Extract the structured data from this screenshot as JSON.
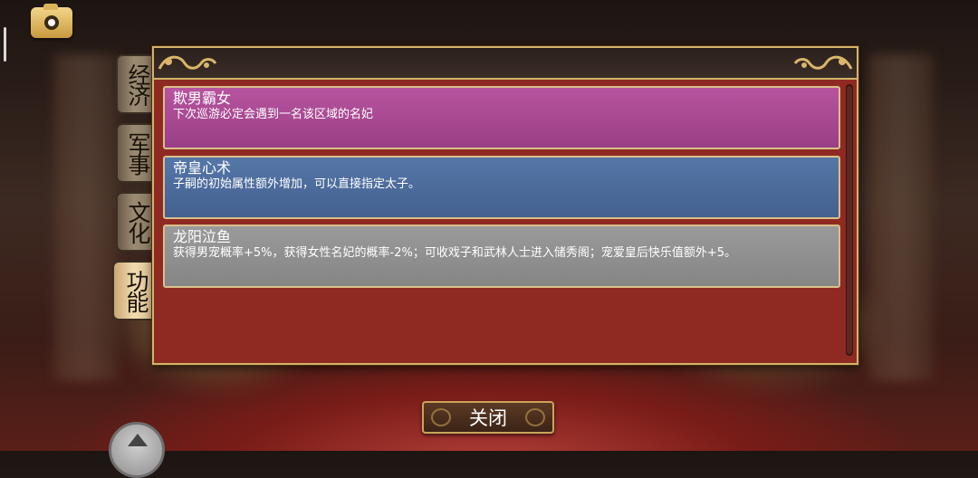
{
  "tabs": [
    {
      "label": "经济",
      "active": false
    },
    {
      "label": "军事",
      "active": false
    },
    {
      "label": "文化",
      "active": false
    },
    {
      "label": "功能",
      "active": true
    }
  ],
  "items": [
    {
      "name": "欺男霸女",
      "desc": "下次巡游必定会遇到一名该区域的名妃",
      "color": "#b04f98"
    },
    {
      "name": "帝皇心术",
      "desc": "子嗣的初始属性额外增加，可以直接指定太子。",
      "color": "#4f6fa0"
    },
    {
      "name": "龙阳泣鱼",
      "desc": "获得男宠概率+5%，获得女性名妃的概率-2%；可收戏子和武林人士进入储秀阁；宠爱皇后快乐值额外+5。",
      "color": "#939393"
    }
  ],
  "close_label": "关闭",
  "icons": {
    "camera": "camera-icon",
    "up": "up-arrow-icon"
  },
  "colors": {
    "panel": "#8f2a23",
    "gold_border": "#d2b46a"
  }
}
